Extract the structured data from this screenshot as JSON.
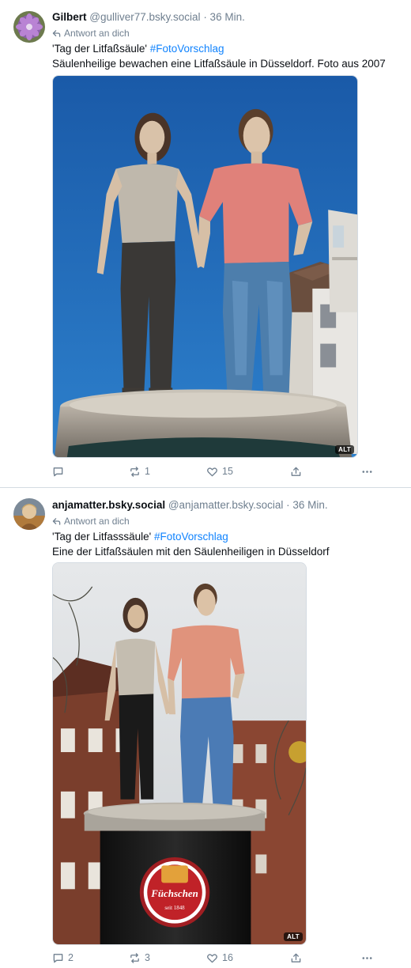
{
  "posts": [
    {
      "author": "Gilbert",
      "handle": "@gulliver77.bsky.social",
      "time": "· 36 Min.",
      "reply_label": "Antwort an dich",
      "line1_text": "'Tag der Litfaßsäule'",
      "line1_tag": "#FotoVorschlag",
      "line2": "Säulenheilige bewachen eine Litfaßsäule in Düsseldorf. Foto aus 2007",
      "alt_badge": "ALT",
      "replies": "",
      "reposts": "1",
      "likes": "15"
    },
    {
      "author": "anjamatter.bsky.social",
      "handle": "@anjamatter.bsky.social",
      "time": "· 36 Min.",
      "reply_label": "Antwort an dich",
      "line1_text": "'Tag der Litfasssäule'",
      "line1_tag": "#FotoVorschlag",
      "line2": "Eine der Litfaßsäulen mit den Säulenheiligen in Düsseldorf",
      "alt_badge": "ALT",
      "replies": "2",
      "reposts": "3",
      "likes": "16",
      "sign_brand": "Füchschen",
      "sign_year": "seit 1848"
    }
  ],
  "icons": {
    "reply": "speech-bubble-icon",
    "repost": "repost-arrows-icon",
    "like": "heart-icon",
    "share": "share-upload-icon",
    "more": "ellipsis-icon",
    "reply_indicator": "reply-arrow-icon"
  },
  "colors": {
    "link": "#1083fe",
    "muted": "#6f7f8f",
    "text": "#0b0f14",
    "divider": "#d4dbe2"
  }
}
